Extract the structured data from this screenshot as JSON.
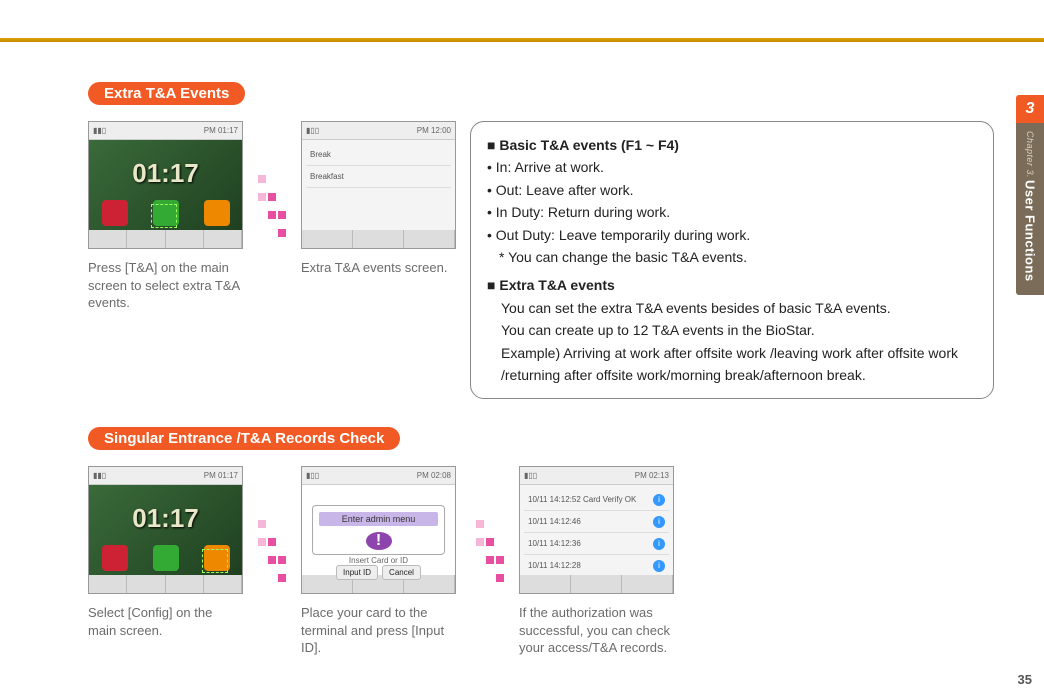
{
  "sidetab": {
    "number": "3",
    "chapter": "Chapter 3.",
    "title": "User Functions"
  },
  "section1": {
    "pill": "Extra T&A Events",
    "thumb1_caption": "Press [T&A] on the main screen to select extra T&A events.",
    "thumb2_caption": "Extra T&A events screen.",
    "clock": "01:17",
    "info": {
      "h1": "Basic T&A events (F1 ~ F4)",
      "b1": "In: Arrive at work.",
      "b2": "Out: Leave after work.",
      "b3": "In Duty: Return during work.",
      "b4": "Out Duty: Leave temporarily during work.",
      "note": "* You can change the basic T&A events.",
      "h2": "Extra T&A events",
      "p1": "You can set the extra T&A events besides of basic T&A events.",
      "p2": "You can create up to 12 T&A events in the BioStar.",
      "p3": "Example) Arriving at work after offsite work /leaving work after offsite work /returning after offsite work/morning break/afternoon break."
    }
  },
  "section2": {
    "pill": "Singular Entrance /T&A Records Check",
    "thumb1_caption": "Select [Config] on the main screen.",
    "thumb2_caption": "Place your card to the terminal and press [Input ID].",
    "thumb3_caption": "If the authorization was successful, you can check your access/T&A records.",
    "clock": "01:17",
    "modal_header": "Enter admin menu",
    "modal_msg": "Insert Card or ID",
    "modal_btn1": "Input ID",
    "modal_btn2": "Cancel"
  },
  "pagenum": "35"
}
